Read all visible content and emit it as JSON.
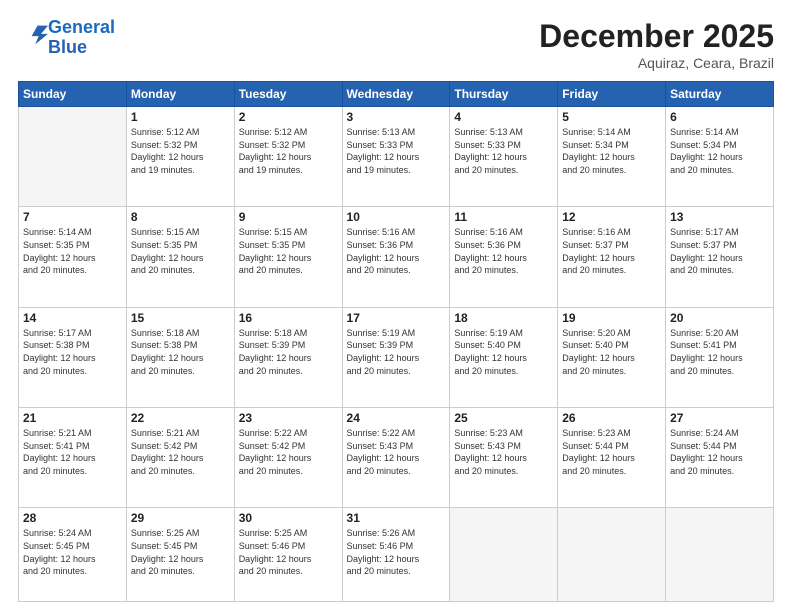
{
  "header": {
    "logo_line1": "General",
    "logo_line2": "Blue",
    "month": "December 2025",
    "location": "Aquiraz, Ceara, Brazil"
  },
  "weekdays": [
    "Sunday",
    "Monday",
    "Tuesday",
    "Wednesday",
    "Thursday",
    "Friday",
    "Saturday"
  ],
  "weeks": [
    [
      {
        "day": "",
        "sunrise": "",
        "sunset": "",
        "daylight": ""
      },
      {
        "day": "1",
        "sunrise": "5:12 AM",
        "sunset": "5:32 PM",
        "daylight": "12 hours and 19 minutes."
      },
      {
        "day": "2",
        "sunrise": "5:12 AM",
        "sunset": "5:32 PM",
        "daylight": "12 hours and 19 minutes."
      },
      {
        "day": "3",
        "sunrise": "5:13 AM",
        "sunset": "5:33 PM",
        "daylight": "12 hours and 19 minutes."
      },
      {
        "day": "4",
        "sunrise": "5:13 AM",
        "sunset": "5:33 PM",
        "daylight": "12 hours and 20 minutes."
      },
      {
        "day": "5",
        "sunrise": "5:14 AM",
        "sunset": "5:34 PM",
        "daylight": "12 hours and 20 minutes."
      },
      {
        "day": "6",
        "sunrise": "5:14 AM",
        "sunset": "5:34 PM",
        "daylight": "12 hours and 20 minutes."
      }
    ],
    [
      {
        "day": "7",
        "sunrise": "5:14 AM",
        "sunset": "5:35 PM",
        "daylight": "12 hours and 20 minutes."
      },
      {
        "day": "8",
        "sunrise": "5:15 AM",
        "sunset": "5:35 PM",
        "daylight": "12 hours and 20 minutes."
      },
      {
        "day": "9",
        "sunrise": "5:15 AM",
        "sunset": "5:35 PM",
        "daylight": "12 hours and 20 minutes."
      },
      {
        "day": "10",
        "sunrise": "5:16 AM",
        "sunset": "5:36 PM",
        "daylight": "12 hours and 20 minutes."
      },
      {
        "day": "11",
        "sunrise": "5:16 AM",
        "sunset": "5:36 PM",
        "daylight": "12 hours and 20 minutes."
      },
      {
        "day": "12",
        "sunrise": "5:16 AM",
        "sunset": "5:37 PM",
        "daylight": "12 hours and 20 minutes."
      },
      {
        "day": "13",
        "sunrise": "5:17 AM",
        "sunset": "5:37 PM",
        "daylight": "12 hours and 20 minutes."
      }
    ],
    [
      {
        "day": "14",
        "sunrise": "5:17 AM",
        "sunset": "5:38 PM",
        "daylight": "12 hours and 20 minutes."
      },
      {
        "day": "15",
        "sunrise": "5:18 AM",
        "sunset": "5:38 PM",
        "daylight": "12 hours and 20 minutes."
      },
      {
        "day": "16",
        "sunrise": "5:18 AM",
        "sunset": "5:39 PM",
        "daylight": "12 hours and 20 minutes."
      },
      {
        "day": "17",
        "sunrise": "5:19 AM",
        "sunset": "5:39 PM",
        "daylight": "12 hours and 20 minutes."
      },
      {
        "day": "18",
        "sunrise": "5:19 AM",
        "sunset": "5:40 PM",
        "daylight": "12 hours and 20 minutes."
      },
      {
        "day": "19",
        "sunrise": "5:20 AM",
        "sunset": "5:40 PM",
        "daylight": "12 hours and 20 minutes."
      },
      {
        "day": "20",
        "sunrise": "5:20 AM",
        "sunset": "5:41 PM",
        "daylight": "12 hours and 20 minutes."
      }
    ],
    [
      {
        "day": "21",
        "sunrise": "5:21 AM",
        "sunset": "5:41 PM",
        "daylight": "12 hours and 20 minutes."
      },
      {
        "day": "22",
        "sunrise": "5:21 AM",
        "sunset": "5:42 PM",
        "daylight": "12 hours and 20 minutes."
      },
      {
        "day": "23",
        "sunrise": "5:22 AM",
        "sunset": "5:42 PM",
        "daylight": "12 hours and 20 minutes."
      },
      {
        "day": "24",
        "sunrise": "5:22 AM",
        "sunset": "5:43 PM",
        "daylight": "12 hours and 20 minutes."
      },
      {
        "day": "25",
        "sunrise": "5:23 AM",
        "sunset": "5:43 PM",
        "daylight": "12 hours and 20 minutes."
      },
      {
        "day": "26",
        "sunrise": "5:23 AM",
        "sunset": "5:44 PM",
        "daylight": "12 hours and 20 minutes."
      },
      {
        "day": "27",
        "sunrise": "5:24 AM",
        "sunset": "5:44 PM",
        "daylight": "12 hours and 20 minutes."
      }
    ],
    [
      {
        "day": "28",
        "sunrise": "5:24 AM",
        "sunset": "5:45 PM",
        "daylight": "12 hours and 20 minutes."
      },
      {
        "day": "29",
        "sunrise": "5:25 AM",
        "sunset": "5:45 PM",
        "daylight": "12 hours and 20 minutes."
      },
      {
        "day": "30",
        "sunrise": "5:25 AM",
        "sunset": "5:46 PM",
        "daylight": "12 hours and 20 minutes."
      },
      {
        "day": "31",
        "sunrise": "5:26 AM",
        "sunset": "5:46 PM",
        "daylight": "12 hours and 20 minutes."
      },
      {
        "day": "",
        "sunrise": "",
        "sunset": "",
        "daylight": ""
      },
      {
        "day": "",
        "sunrise": "",
        "sunset": "",
        "daylight": ""
      },
      {
        "day": "",
        "sunrise": "",
        "sunset": "",
        "daylight": ""
      }
    ]
  ],
  "labels": {
    "sunrise": "Sunrise:",
    "sunset": "Sunset:",
    "daylight": "Daylight:"
  }
}
